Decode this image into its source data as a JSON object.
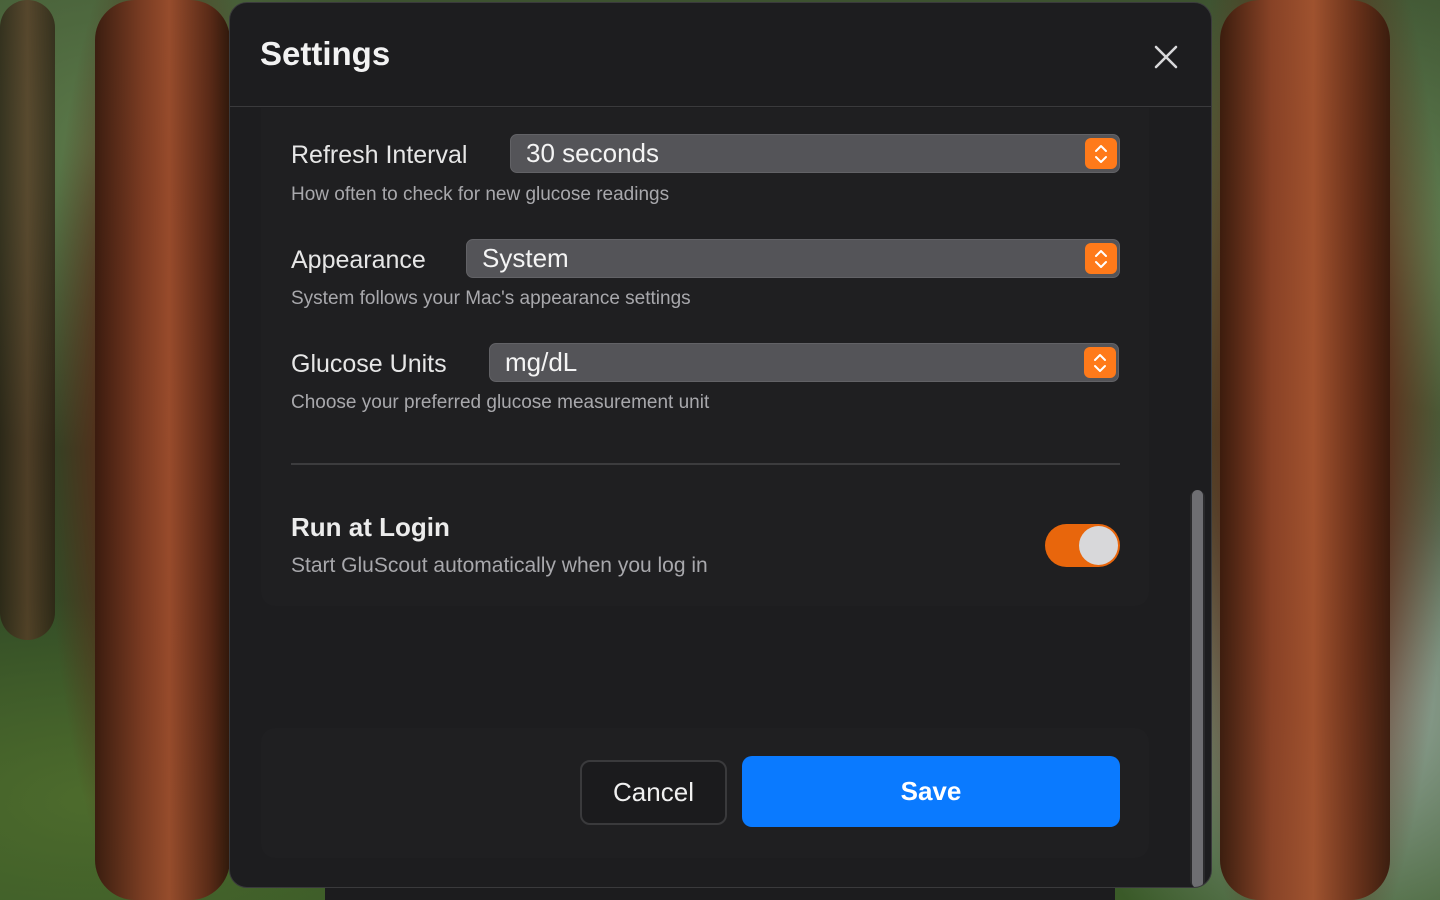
{
  "dialog": {
    "title": "Settings"
  },
  "settings": [
    {
      "label": "Refresh Interval",
      "value": "30 seconds",
      "description": "How often to check for new glucose readings"
    },
    {
      "label": "Appearance",
      "value": "System",
      "description": "System follows your Mac's appearance settings"
    },
    {
      "label": "Glucose Units",
      "value": "mg/dL",
      "description": "Choose your preferred glucose measurement unit"
    }
  ],
  "run_at_login": {
    "title": "Run at Login",
    "description": "Start GluScout automatically when you log in",
    "enabled": true
  },
  "buttons": {
    "cancel": "Cancel",
    "save": "Save"
  },
  "colors": {
    "accent": "#0a7aff",
    "toggle_on": "#e8660c",
    "stepper": "#ff7a1a",
    "dialog_bg": "#1d1d1f"
  },
  "icons": {
    "close": "close-icon",
    "stepper": "chevron-up-down-icon"
  }
}
